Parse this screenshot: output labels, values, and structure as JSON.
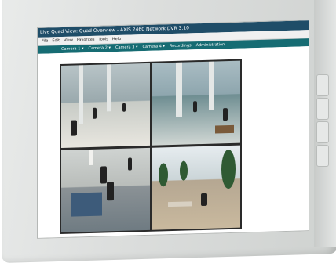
{
  "window": {
    "title": "Live Quad View: Quad Overview - AXIS 2460 Network DVR 3.10"
  },
  "menu": [
    "File",
    "Edit",
    "View",
    "Favorites",
    "Tools",
    "Help"
  ],
  "nav": [
    "Camera 1 ▾",
    "Camera 2 ▾",
    "Camera 3 ▾",
    "Camera 4 ▾",
    "Recordings",
    "Administration"
  ],
  "cameras": [
    "lobby-camera",
    "hall-camera",
    "reception-camera",
    "cafe-camera"
  ]
}
